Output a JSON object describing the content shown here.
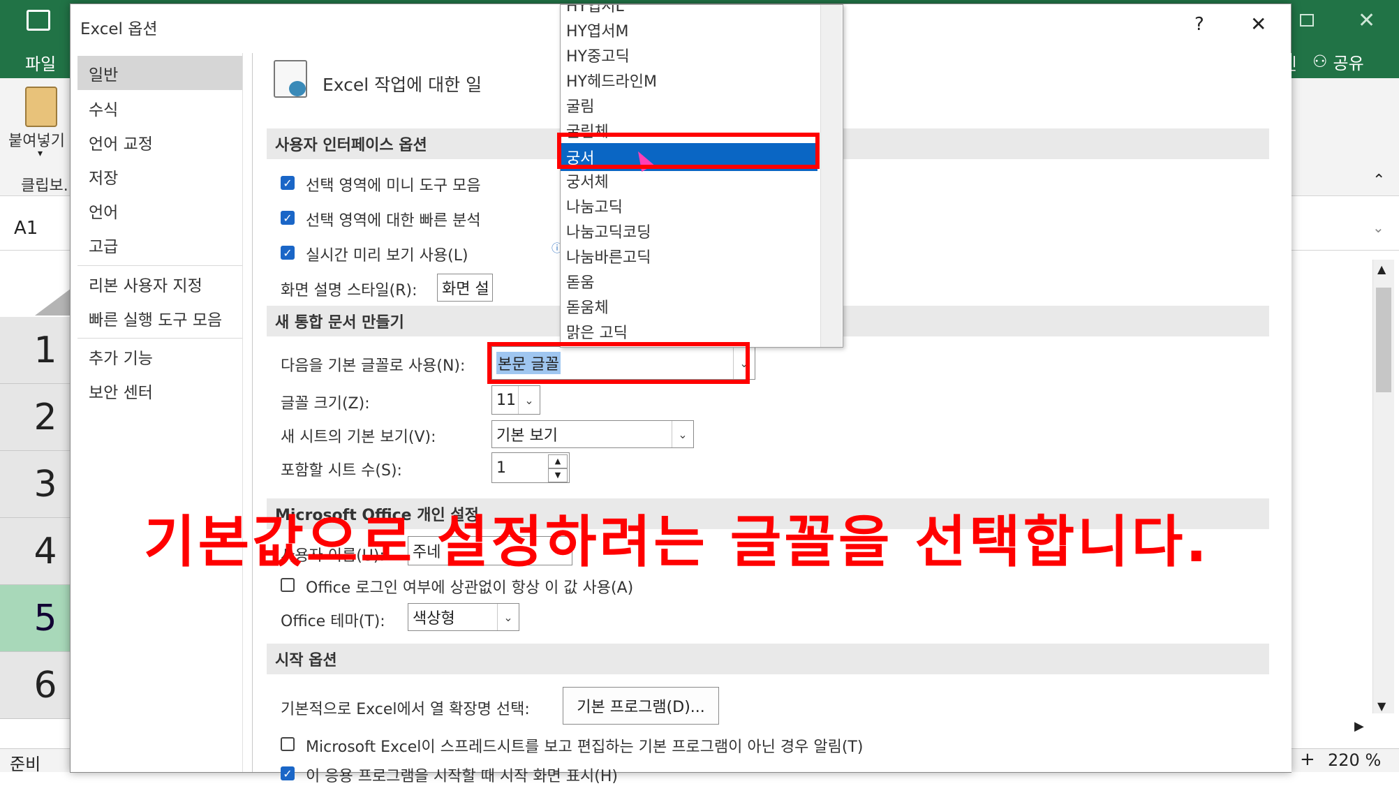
{
  "excel": {
    "tab_file": "파일",
    "signin_partial": "인",
    "share": "공유",
    "paste_label": "붙여넣기",
    "clipboard_label": "클립보...",
    "name_box": "A1",
    "row_numbers": [
      "1",
      "2",
      "3",
      "4",
      "5",
      "6"
    ],
    "status": "준비",
    "zoom": "220 %"
  },
  "dialog": {
    "title": "Excel 옵션",
    "help": "?",
    "close": "✕",
    "nav": [
      {
        "label": "일반"
      },
      {
        "label": "수식"
      },
      {
        "label": "언어 교정"
      },
      {
        "label": "저장"
      },
      {
        "label": "언어"
      },
      {
        "label": "고급"
      },
      {
        "label": "리본 사용자 지정"
      },
      {
        "label": "빠른 실행 도구 모음"
      },
      {
        "label": "추가 기능"
      },
      {
        "label": "보안 센터"
      }
    ],
    "header_text": "Excel 작업에 대한 일",
    "ui_section": "사용자 인터페이스 옵션",
    "cb_mini_toolbar": "선택 영역에 미니 도구 모음",
    "cb_quick_analysis": "선택 영역에 대한 빠른 분석",
    "cb_live_preview": "실시간 미리 보기 사용(L)",
    "tooltip_style_label": "화면 설명 스타일(R):",
    "tooltip_style_value": "화면 설",
    "new_wb_section": "새 통합 문서 만들기",
    "default_font_label": "다음을 기본 글꼴로 사용(N):",
    "default_font_value": "본문 글꼴",
    "font_size_label": "글꼴 크기(Z):",
    "font_size_value": "11",
    "default_view_label": "새 시트의 기본 보기(V):",
    "default_view_value": "기본 보기",
    "sheet_count_label": "포함할 시트 수(S):",
    "sheet_count_value": "1",
    "personalize_section": "Microsoft Office 개인 설정",
    "username_label": "사용자 이름(U):",
    "username_value": "주네",
    "always_use_label": "Office 로그인 여부에 상관없이 항상 이 값 사용(A)",
    "theme_label": "Office 테마(T):",
    "theme_value": "색상형",
    "startup_section": "시작 옵션",
    "ext_label": "기본적으로 Excel에서 열 확장명 선택:",
    "default_programs_button": "기본 프로그램(D)...",
    "notify_label": "Microsoft Excel이 스프레드시트를 보고 편집하는 기본 프로그램이 아닌 경우 알림(T)",
    "startup_screen_label": "이 응용 프로그램을 시작할 때 시작 화면 표시(H)"
  },
  "font_list": {
    "items": [
      "HY엽서L",
      "HY엽서M",
      "HY중고딕",
      "HY헤드라인M",
      "굴림",
      "굴림체",
      "궁서",
      "궁서체",
      "나눔고딕",
      "나눔고딕코딩",
      "나눔바른고딕",
      "돋움",
      "돋움체",
      "맑은 고딕"
    ],
    "selected": "궁서"
  },
  "annotation": {
    "caption": "기본값으로 설정하려는 글꼴을 선택합니다.",
    "color": "#ff0000"
  }
}
